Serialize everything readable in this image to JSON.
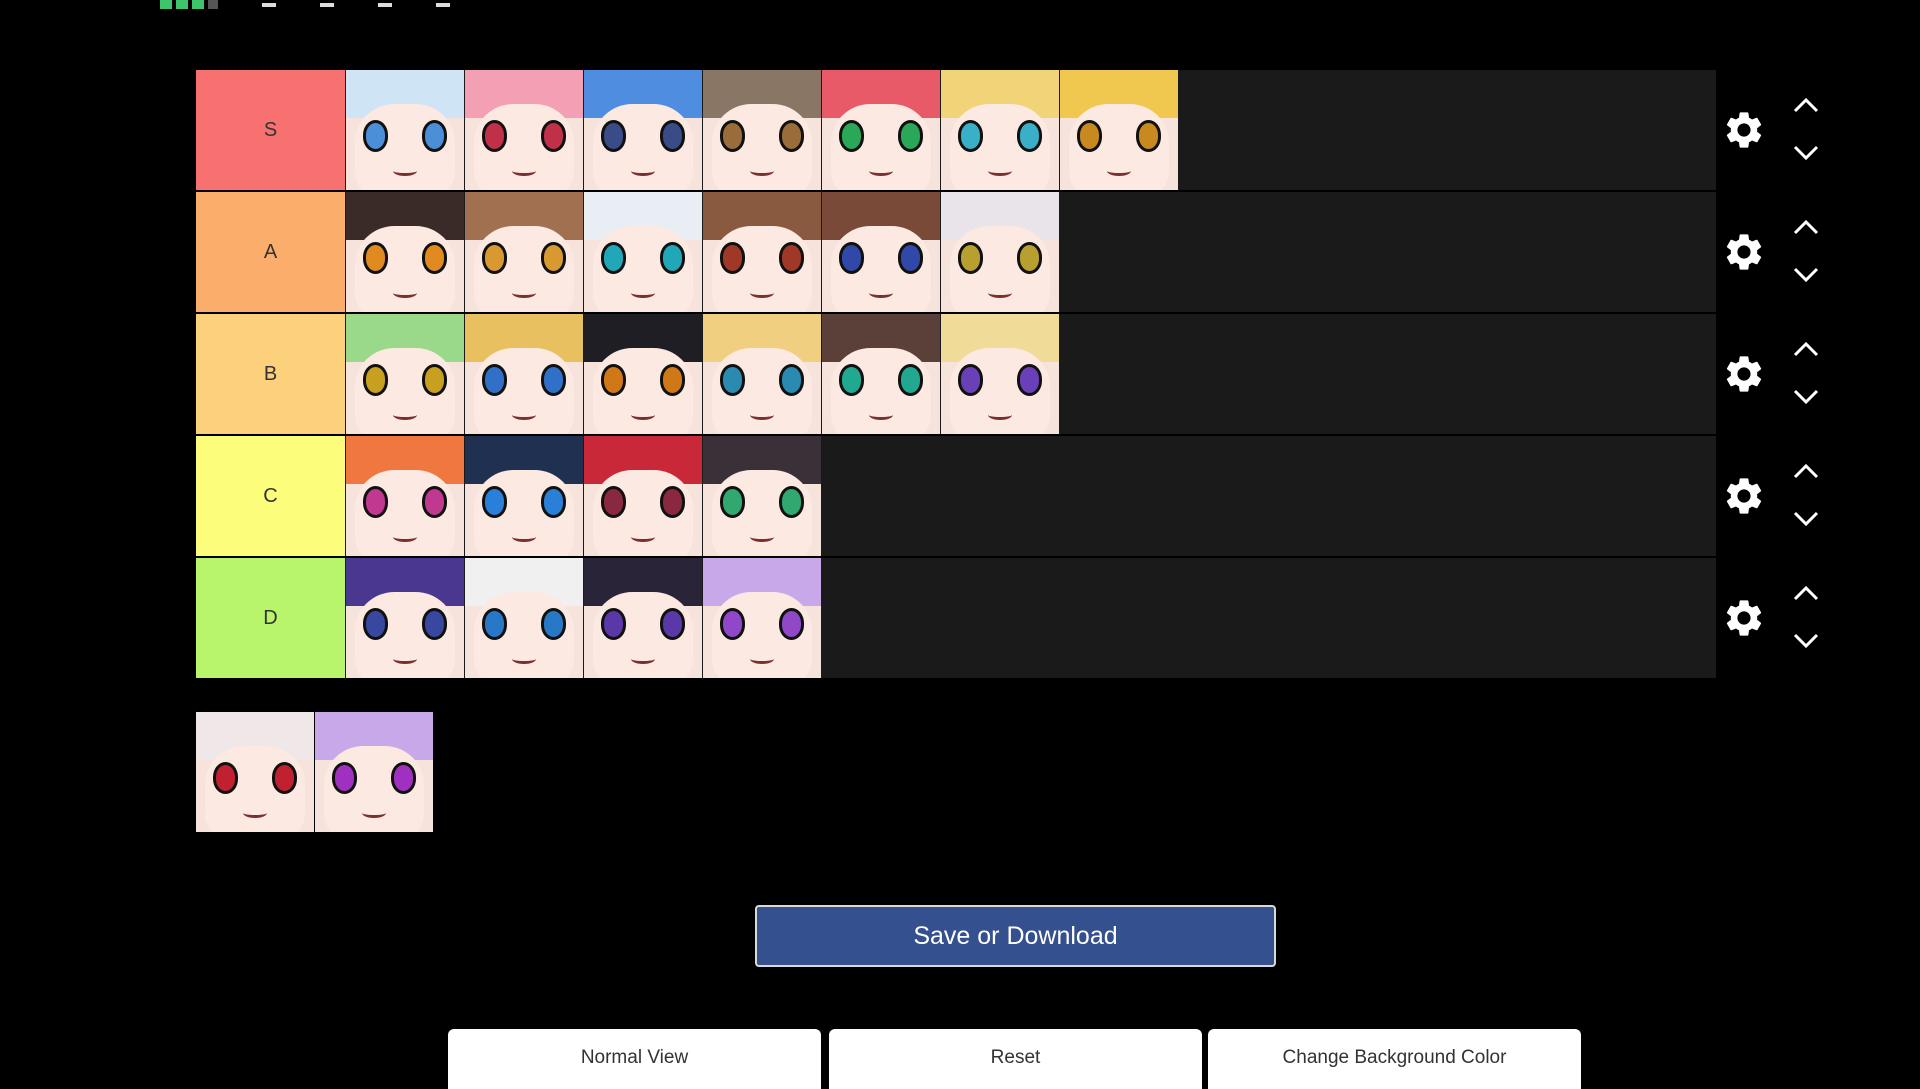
{
  "tiers": [
    {
      "label": "S",
      "color": "#f87171",
      "items": [
        {
          "hair": "#cfe4f5",
          "eye": "#4a8fd8"
        },
        {
          "hair": "#f4a0b4",
          "eye": "#c03048"
        },
        {
          "hair": "#4f8de0",
          "eye": "#3a4c88"
        },
        {
          "hair": "#8a7664",
          "eye": "#9a6c3a"
        },
        {
          "hair": "#e85a68",
          "eye": "#2aa858"
        },
        {
          "hair": "#f2d478",
          "eye": "#3ab0c8"
        },
        {
          "hair": "#f0c850",
          "eye": "#c88a20"
        }
      ]
    },
    {
      "label": "A",
      "color": "#fbad6b",
      "items": [
        {
          "hair": "#3a2a28",
          "eye": "#e08a20"
        },
        {
          "hair": "#a07050",
          "eye": "#d89a30"
        },
        {
          "hair": "#e8eef4",
          "eye": "#20a8b8"
        },
        {
          "hair": "#8a5a40",
          "eye": "#a03828"
        },
        {
          "hair": "#7a4a38",
          "eye": "#3048a8"
        },
        {
          "hair": "#e8e4ea",
          "eye": "#b8a030"
        }
      ]
    },
    {
      "label": "B",
      "color": "#fdd07c",
      "items": [
        {
          "hair": "#9ad88a",
          "eye": "#c8a020"
        },
        {
          "hair": "#e8c060",
          "eye": "#3070c8"
        },
        {
          "hair": "#1e1e24",
          "eye": "#d07818"
        },
        {
          "hair": "#f0d080",
          "eye": "#2a8ab0"
        },
        {
          "hair": "#5a4038",
          "eye": "#20a890"
        },
        {
          "hair": "#f0dc98",
          "eye": "#6a40b8"
        }
      ]
    },
    {
      "label": "C",
      "color": "#fdfd7c",
      "items": [
        {
          "hair": "#f07840",
          "eye": "#c03890"
        },
        {
          "hair": "#203050",
          "eye": "#2a80d8"
        },
        {
          "hair": "#c82838",
          "eye": "#8a2840"
        },
        {
          "hair": "#3a3038",
          "eye": "#30a870"
        }
      ]
    },
    {
      "label": "D",
      "color": "#b8f56a",
      "items": [
        {
          "hair": "#4a3890",
          "eye": "#3848a0"
        },
        {
          "hair": "#f0f0f0",
          "eye": "#2878c8"
        },
        {
          "hair": "#2a2438",
          "eye": "#5a38a8"
        },
        {
          "hair": "#c8a8e8",
          "eye": "#9048c8"
        }
      ]
    }
  ],
  "pool": [
    {
      "hair": "#f0e8e8",
      "eye": "#c02030"
    },
    {
      "hair": "#c8a8e8",
      "eye": "#a030c0"
    }
  ],
  "buttons": {
    "save": "Save or Download",
    "normal_view": "Normal View",
    "reset": "Reset",
    "change_bg": "Change Background Color"
  },
  "icons": {
    "settings": "gear-icon",
    "move_up": "chevron-up-icon",
    "move_down": "chevron-down-icon"
  }
}
